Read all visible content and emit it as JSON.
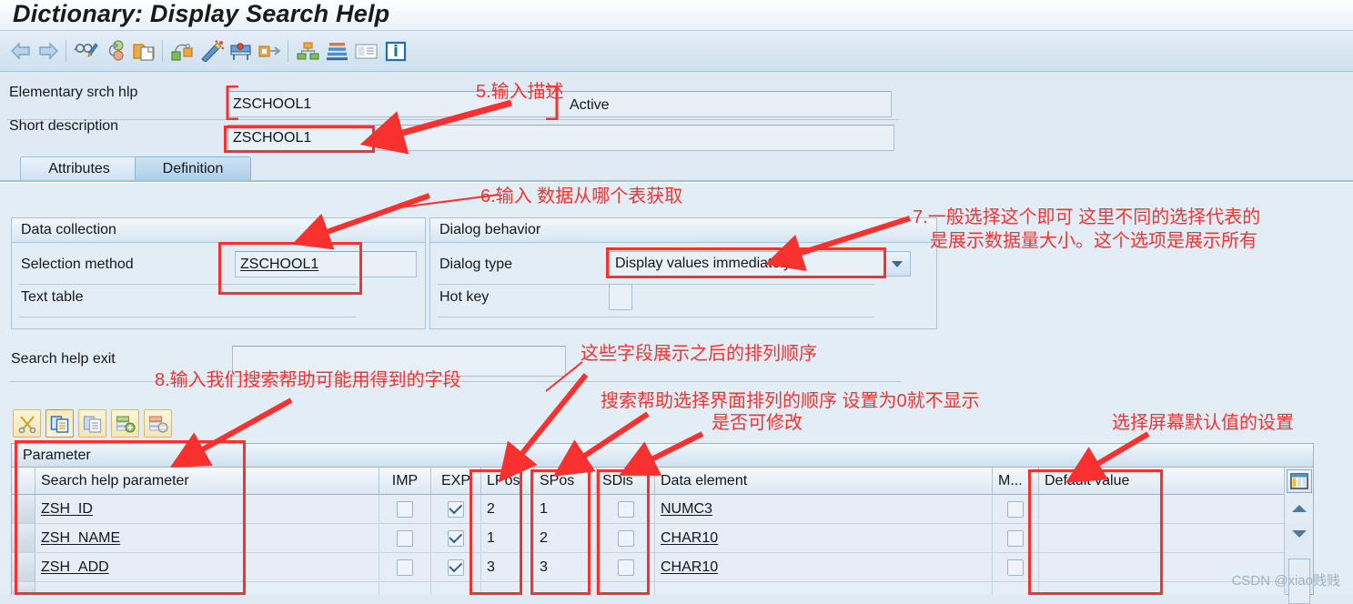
{
  "window": {
    "title": "Dictionary: Display Search Help"
  },
  "toolbar": {
    "icons": [
      {
        "name": "back-arrow-icon",
        "title": "Back"
      },
      {
        "name": "forward-arrow-icon",
        "title": "Forward"
      },
      {
        "name": "display-change-icon",
        "title": "Display <-> Change"
      },
      {
        "name": "where-used-list-icon",
        "title": "Where-Used List"
      },
      {
        "name": "copy-object-icon",
        "title": "Copy"
      },
      {
        "name": "activate-icon",
        "title": "Activate"
      },
      {
        "name": "check-icon",
        "title": "Check"
      },
      {
        "name": "test-icon",
        "title": "Test"
      },
      {
        "name": "runtime-object-icon",
        "title": "Runtime Object"
      },
      {
        "name": "hierarchy-icon",
        "title": "Hierarchy"
      },
      {
        "name": "append-icon",
        "title": "Append"
      },
      {
        "name": "documentation-icon",
        "title": "Documentation"
      },
      {
        "name": "information-icon",
        "title": "Information"
      }
    ]
  },
  "form": {
    "elementary_label": "Elementary srch hlp",
    "elementary_value": "ZSCHOOL1",
    "status": "Active",
    "short_desc_label": "Short description",
    "short_desc_value": "ZSCHOOL1"
  },
  "tabs": [
    {
      "label": "Attributes",
      "active": false
    },
    {
      "label": "Definition",
      "active": true
    }
  ],
  "data_collection": {
    "title": "Data collection",
    "selection_method_label": "Selection method",
    "selection_method_value": "ZSCHOOL1",
    "text_table_label": "Text table",
    "text_table_value": ""
  },
  "dialog_behavior": {
    "title": "Dialog behavior",
    "dialog_type_label": "Dialog type",
    "dialog_type_value": "Display values immediately",
    "hot_key_label": "Hot key",
    "hot_key_value": ""
  },
  "search_help_exit": {
    "label": "Search help exit",
    "value": ""
  },
  "table_toolbar": {
    "buttons": [
      {
        "name": "cut-icon"
      },
      {
        "name": "copy-icon"
      },
      {
        "name": "paste-icon"
      },
      {
        "name": "insert-row-icon"
      },
      {
        "name": "delete-row-icon"
      }
    ]
  },
  "table": {
    "title": "Parameter",
    "columns": [
      "Search help parameter",
      "IMP",
      "EXP",
      "LPos",
      "SPos",
      "SDis",
      "Data element",
      "M...",
      "Default value"
    ],
    "rows": [
      {
        "parameter": "ZSH_ID",
        "imp": false,
        "exp": true,
        "lpos": "2",
        "spos": "1",
        "sdis": false,
        "data_element": "NUMC3",
        "mod": false,
        "default_value": ""
      },
      {
        "parameter": "ZSH_NAME",
        "imp": false,
        "exp": true,
        "lpos": "1",
        "spos": "2",
        "sdis": false,
        "data_element": "CHAR10",
        "mod": false,
        "default_value": ""
      },
      {
        "parameter": "ZSH_ADD",
        "imp": false,
        "exp": true,
        "lpos": "3",
        "spos": "3",
        "sdis": false,
        "data_element": "CHAR10",
        "mod": false,
        "default_value": ""
      }
    ],
    "rail": {
      "config-icon": "table-settings-icon",
      "scroll_up": "scroll-up-icon",
      "scroll_down": "scroll-down-icon"
    }
  },
  "annotations": [
    {
      "id": "a5",
      "text": "5.输入描述"
    },
    {
      "id": "a6",
      "text": "6.输入 数据从哪个表获取"
    },
    {
      "id": "a7a",
      "text": "7.一般选择这个即可 这里不同的选择代表的"
    },
    {
      "id": "a7b",
      "text": "是展示数据量大小。这个选项是展示所有"
    },
    {
      "id": "a9",
      "text": "这些字段展示之后的排列顺序"
    },
    {
      "id": "a8",
      "text": "8.输入我们搜索帮助可能用得到的字段"
    },
    {
      "id": "a10",
      "text": "搜索帮助选择界面排列的顺序 设置为0就不显示"
    },
    {
      "id": "a11",
      "text": "是否可修改"
    },
    {
      "id": "a12",
      "text": "选择屏幕默认值的设置"
    }
  ],
  "watermark": "CSDN @xiao贱贱",
  "colors": {
    "annotation_red": "#f8312f",
    "panel_bg": "#e3edf6",
    "field_bg": "#e9f1f8"
  }
}
